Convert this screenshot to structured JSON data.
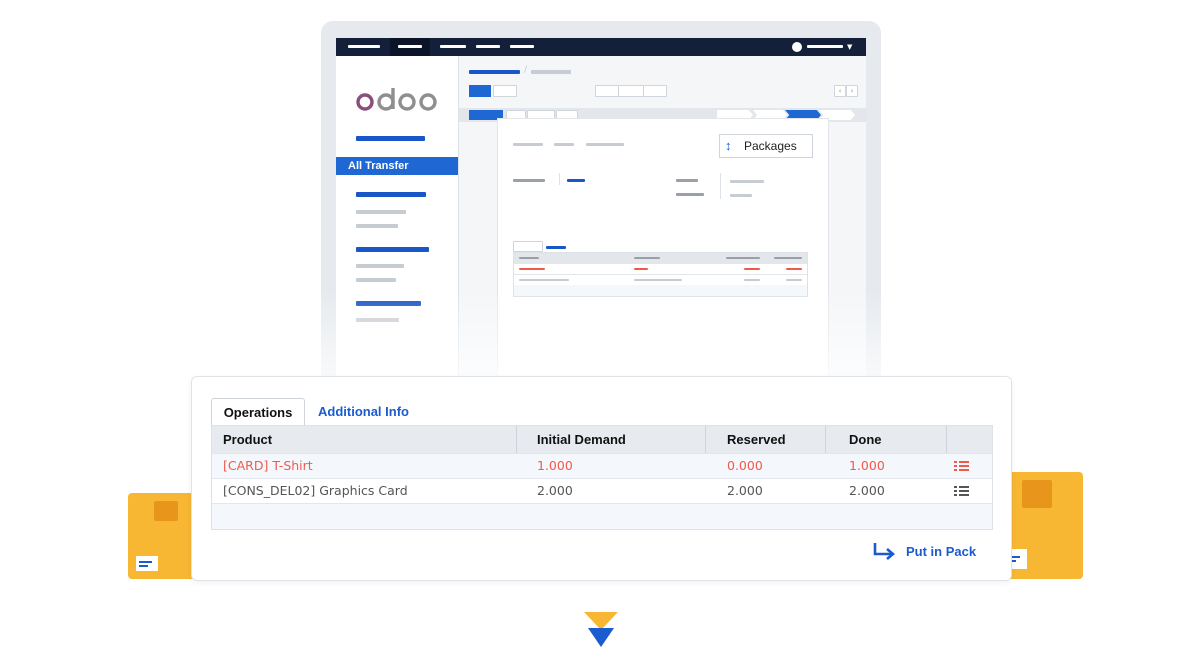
{
  "brand": {
    "logo_text": "odoo",
    "logo_color": "#8a4d7c"
  },
  "sidebar": {
    "active_item": "All Transfer"
  },
  "packages_button": {
    "label": "Packages",
    "icon": "up-down-arrow-icon"
  },
  "zoom": {
    "tabs": [
      {
        "label": "Operations",
        "active": true
      },
      {
        "label": "Additional Info",
        "active": false
      }
    ],
    "columns": [
      "Product",
      "Initial Demand",
      "Reserved",
      "Done"
    ],
    "rows": [
      {
        "product": "[CARD] T-Shirt",
        "initial_demand": "1.000",
        "reserved": "0.000",
        "done": "1.000",
        "status": "warning",
        "icon": "list-icon"
      },
      {
        "product": "[CONS_DEL02] Graphics Card",
        "initial_demand": "2.000",
        "reserved": "2.000",
        "done": "2.000",
        "status": "normal",
        "icon": "list-icon"
      }
    ],
    "action": {
      "label": "Put in Pack",
      "icon": "return-arrow-icon"
    }
  },
  "colors": {
    "accent": "#1a5bd0",
    "warning": "#f05a4b",
    "box": "#f7b733",
    "nav": "#141f3a"
  }
}
